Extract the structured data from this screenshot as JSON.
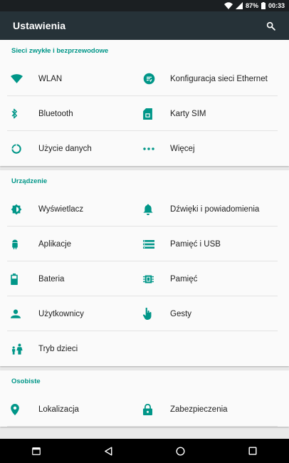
{
  "status": {
    "battery": "87%",
    "time": "00:33",
    "accent": "#009688"
  },
  "appbar": {
    "title": "Ustawienia",
    "search_icon": "search-icon"
  },
  "sections": [
    {
      "title": "Sieci zwykłe i bezprzewodowe",
      "items": [
        {
          "label": "WLAN",
          "icon": "wifi-icon"
        },
        {
          "label": "Konfiguracja sieci Ethernet",
          "icon": "ethernet-icon"
        },
        {
          "label": "Bluetooth",
          "icon": "bluetooth-icon"
        },
        {
          "label": "Karty SIM",
          "icon": "sim-card-icon"
        },
        {
          "label": "Użycie danych",
          "icon": "data-usage-icon"
        },
        {
          "label": "Więcej",
          "icon": "more-icon"
        }
      ]
    },
    {
      "title": "Urządzenie",
      "items": [
        {
          "label": "Wyświetlacz",
          "icon": "display-icon"
        },
        {
          "label": "Dźwięki i powiadomienia",
          "icon": "bell-icon"
        },
        {
          "label": "Aplikacje",
          "icon": "android-icon"
        },
        {
          "label": "Pamięć i USB",
          "icon": "storage-icon"
        },
        {
          "label": "Bateria",
          "icon": "battery-icon"
        },
        {
          "label": "Pamięć",
          "icon": "memory-icon"
        },
        {
          "label": "Użytkownicy",
          "icon": "person-icon"
        },
        {
          "label": "Gesty",
          "icon": "gesture-icon"
        },
        {
          "label": "Tryb dzieci",
          "icon": "kids-icon"
        }
      ]
    },
    {
      "title": "Osobiste",
      "items": [
        {
          "label": "Lokalizacja",
          "icon": "location-icon"
        },
        {
          "label": "Zabezpieczenia",
          "icon": "lock-icon"
        }
      ]
    }
  ],
  "navbar": {
    "buttons": [
      "recents-apps-icon",
      "back-icon",
      "home-icon",
      "overview-icon"
    ]
  }
}
